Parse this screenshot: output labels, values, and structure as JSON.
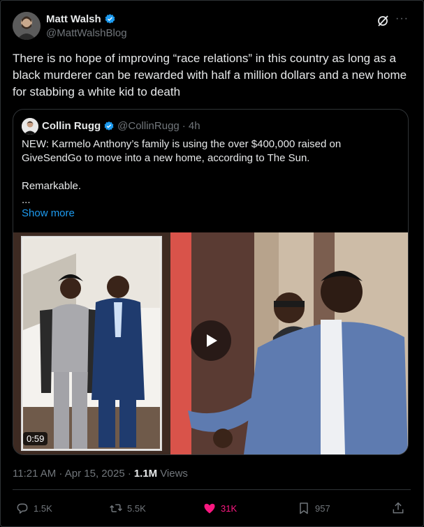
{
  "author": {
    "name": "Matt Walsh",
    "handle": "@MattWalshBlog",
    "verified_color": "#1d9bf0"
  },
  "tweet": {
    "text": "There is no hope of improving “race relations” in this country as long as a black murderer can be rewarded with half a million dollars and a new home for stabbing a white kid to death"
  },
  "quote": {
    "name": "Collin Rugg",
    "handle": "@CollinRugg",
    "time": "· 4h",
    "text": "NEW: Karmelo Anthony’s family is using the over $400,000 raised on GiveSendGo to move into a new home, according to The Sun.\n\nRemarkable.\n...",
    "show_more": "Show more",
    "video_duration": "0:59"
  },
  "meta": {
    "timestamp": "11:21 AM · Apr 15, 2025 ·",
    "views_count": "1.1M",
    "views_label": "Views"
  },
  "actions": {
    "replies": "1.5K",
    "reposts": "5.5K",
    "likes": "31K",
    "bookmarks": "957"
  },
  "colors": {
    "accent": "#1d9bf0",
    "like": "#f91880",
    "muted": "#71767b",
    "border": "#2f3336"
  },
  "icons": [
    "verified-badge-icon",
    "grok-icon",
    "more-icon",
    "play-icon",
    "reply-icon",
    "repost-icon",
    "like-icon",
    "bookmark-icon",
    "share-icon"
  ]
}
